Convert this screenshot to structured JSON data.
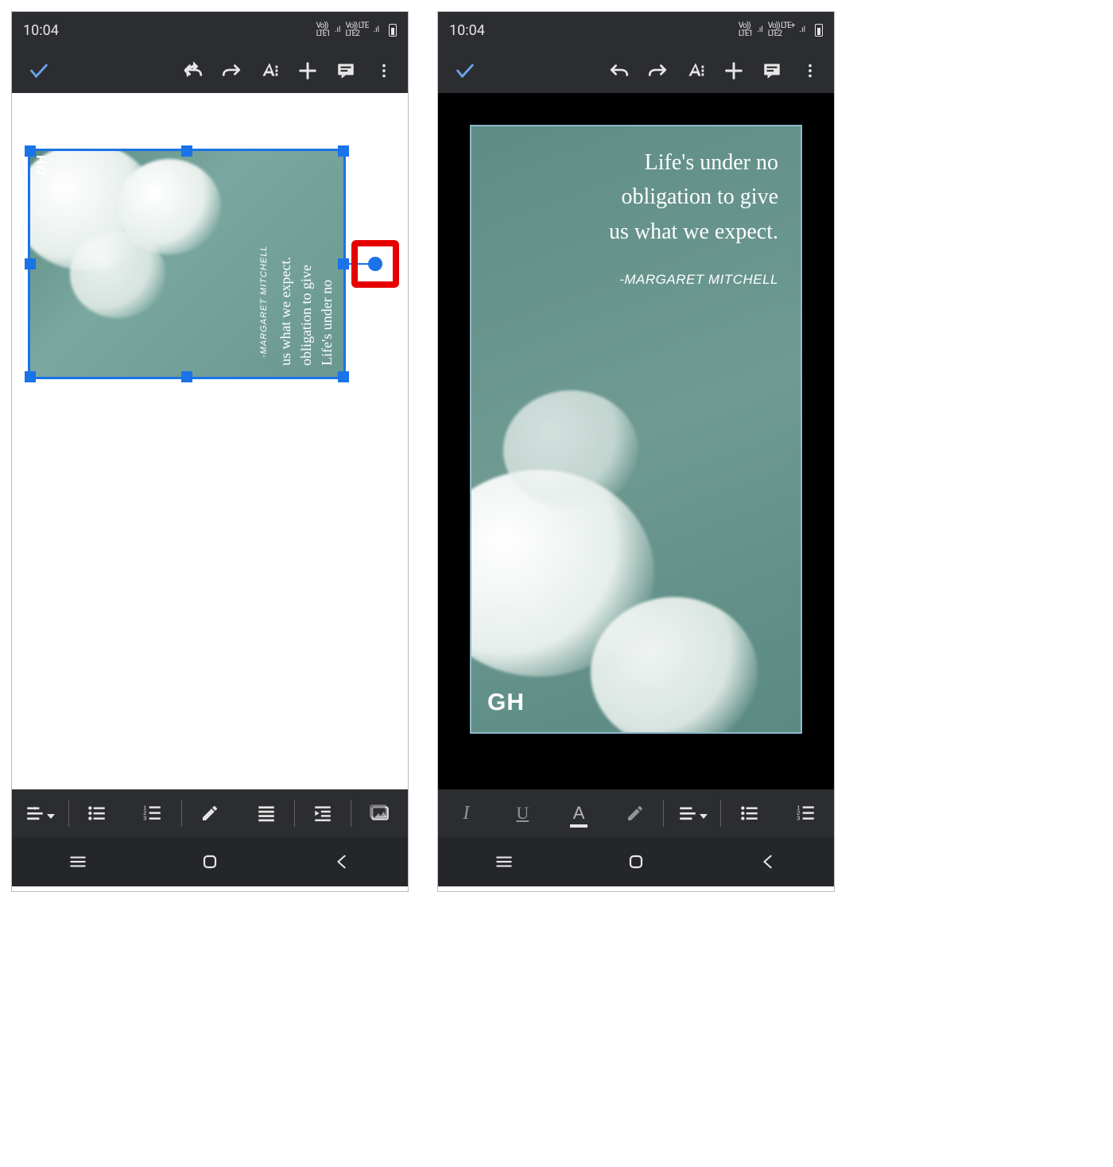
{
  "status": {
    "time": "10:04",
    "net_left_top": "Vo))",
    "net_left_bottom": "LTE1",
    "net_right_top": "Vo)) LTE",
    "net_right_bottom": "LTE2",
    "net_right_top_alt": "Vo)) LTE+",
    "colors": {
      "bar_bg": "#2c2d30",
      "text": "#e6e6e6"
    }
  },
  "toolbar": {
    "check_icon": "check-icon",
    "undo_icon": "undo-icon",
    "redo_icon": "redo-icon",
    "textformat_icon": "text-format-icon",
    "add_icon": "add-icon",
    "comment_icon": "comment-icon",
    "overflow_icon": "more-vert-icon",
    "accent": "#6aa3e8"
  },
  "image_content": {
    "logo": "GH",
    "quote_line1": "Life's under no",
    "quote_line2": "obligation to give",
    "quote_line3": "us what we expect.",
    "author": "-MARGARET MITCHELL",
    "selection_color": "#1a73e8",
    "highlight_color": "#e60000",
    "bg_color": "#6a9890"
  },
  "format_bar_left": {
    "items": [
      {
        "name": "align-menu-icon"
      },
      {
        "name": "bullet-list-icon"
      },
      {
        "name": "number-list-icon"
      },
      {
        "name": "edit-pencil-icon"
      },
      {
        "name": "justify-icon"
      },
      {
        "name": "indent-icon"
      },
      {
        "name": "insert-image-icon"
      }
    ]
  },
  "format_bar_right": {
    "items": [
      {
        "name": "italic-icon",
        "label": "I"
      },
      {
        "name": "underline-icon",
        "label": "U"
      },
      {
        "name": "text-color-icon",
        "label": "A"
      },
      {
        "name": "highlight-pencil-icon"
      },
      {
        "name": "align-menu-icon"
      },
      {
        "name": "bullet-list-icon"
      },
      {
        "name": "number-list-icon"
      }
    ]
  },
  "nav": {
    "recents_icon": "recents-icon",
    "home_icon": "home-icon",
    "back_icon": "back-icon"
  }
}
